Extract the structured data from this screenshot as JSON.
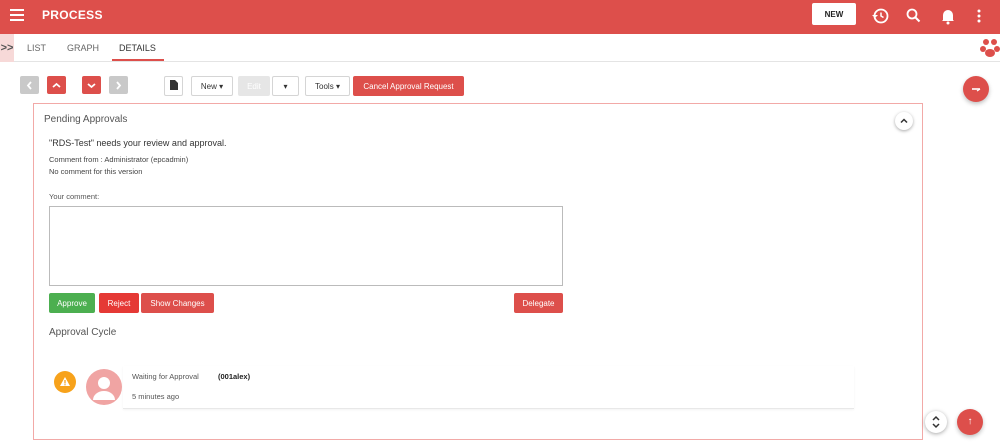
{
  "header": {
    "title": "PROCESS",
    "new_label": "NEW",
    "accent_color": "#dd4f4b",
    "icons": [
      "menu-icon",
      "history-icon",
      "search-icon",
      "bell-icon",
      "more-vert-icon"
    ]
  },
  "tabs": {
    "expand_label": ">>",
    "items": [
      {
        "label": "LIST"
      },
      {
        "label": "GRAPH"
      },
      {
        "label": "DETAILS",
        "active": true
      }
    ]
  },
  "toolbar": {
    "new_label": "New",
    "edit_label": "Edit",
    "tools_label": "Tools",
    "cancel_label": "Cancel Approval Request",
    "icons": [
      "chevron-left-icon",
      "chevron-up-icon",
      "chevron-down-icon",
      "chevron-right-icon",
      "document-icon"
    ]
  },
  "panel": {
    "title": "Pending Approvals",
    "review_message": "\"RDS-Test\" needs your review and approval.",
    "comment_from": "Comment from : Administrator (epcadmin)",
    "no_comment": "No comment for this version",
    "your_comment_label": "Your comment:",
    "comment_value": "",
    "approve_label": "Approve",
    "reject_label": "Reject",
    "show_changes_label": "Show Changes",
    "delegate_label": "Delegate",
    "cycle_title": "Approval Cycle",
    "cycle": {
      "status": "Waiting for Approval",
      "user": "(001alex)",
      "time": "5 minutes ago"
    }
  },
  "colors": {
    "approve": "#4caf50",
    "reject": "#e53935",
    "warning": "#f7a21b"
  }
}
